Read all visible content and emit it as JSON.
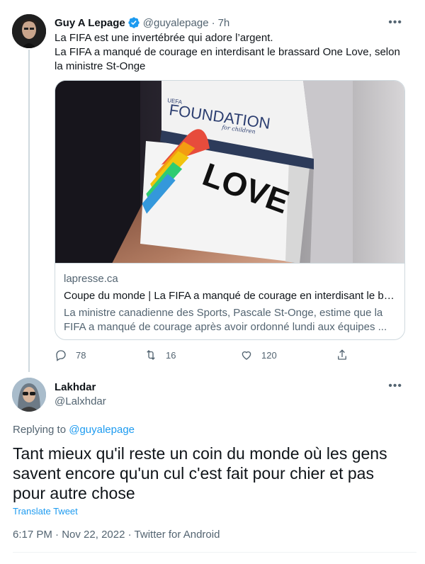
{
  "parent_tweet": {
    "author_name": "Guy A Lepage",
    "author_handle": "@guyalepage",
    "time_ago": "7h",
    "separator": "·",
    "text_line1": "La FIFA est une invertébrée qui adore l’argent.",
    "text_line2": "La FIFA a manqué de courage en interdisant le brassard One Love, selon la ministre St-Onge",
    "card": {
      "domain": "lapresse.ca",
      "title": "Coupe du monde | La FIFA a manqué de courage en interdisant le bras...",
      "description": "La ministre canadienne des Sports, Pascale St-Onge, estime que la FIFA a manqué de courage après avoir ordonné lundi aux équipes ...",
      "image_armband_text": "LOVE",
      "image_sleeve_text": "FOUNDATION",
      "image_sleeve_subtext": "for children",
      "image_sleeve_small": "UEFA"
    },
    "replies": "78",
    "retweets": "16",
    "likes": "120"
  },
  "reply_tweet": {
    "author_name": "Lakhdar",
    "author_handle": "@Lalxhdar",
    "replying_to_label": "Replying to",
    "replying_to_handle": "@guyalepage",
    "text": "Tant mieux qu'il reste un coin du monde où les gens savent encore qu'un cul c'est fait pour chier et pas pour autre chose",
    "translate_label": "Translate Tweet",
    "time": "6:17 PM",
    "date": "Nov 22, 2022",
    "source": "Twitter for Android",
    "separator": "·"
  },
  "colors": {
    "accent": "#1d9bf0",
    "text_primary": "#0f1419",
    "text_secondary": "#536471",
    "border": "#cfd9de"
  },
  "icons": [
    "verified-badge-icon",
    "more-icon",
    "reply-icon",
    "retweet-icon",
    "like-icon",
    "share-icon"
  ]
}
